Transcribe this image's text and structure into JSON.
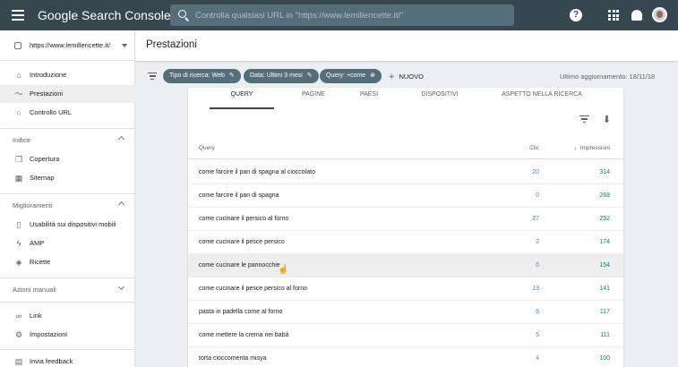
{
  "app": {
    "brand": "Google Search Console",
    "search_placeholder": "Controlla qualsiasi URL in \"https://www.lemillericette.it/\""
  },
  "colors": {
    "topbar": "#37474f",
    "chip": "#546e7a",
    "clicks": "#4285f4",
    "impressions": "#00897b"
  },
  "sidebar": {
    "property": "https://www.lemillericette.it/",
    "items_top": [
      {
        "label": "Introduzione",
        "icon": "home-icon"
      },
      {
        "label": "Prestazioni",
        "icon": "trending-icon"
      },
      {
        "label": "Controllo URL",
        "icon": "search-icon"
      }
    ],
    "index": {
      "title": "Indice",
      "items": [
        {
          "label": "Copertura",
          "icon": "copy-icon"
        },
        {
          "label": "Sitemap",
          "icon": "sitemap-icon"
        }
      ]
    },
    "enhancements": {
      "title": "Miglioramenti",
      "items": [
        {
          "label": "Usabilità sui dispositivi mobili",
          "icon": "mobile-icon"
        },
        {
          "label": "AMP",
          "icon": "amp-icon"
        },
        {
          "label": "Ricette",
          "icon": "layers-icon"
        }
      ]
    },
    "manual": {
      "title": "Azioni manuali"
    },
    "items_bottom": [
      {
        "label": "Link",
        "icon": "link-icon"
      },
      {
        "label": "Impostazioni",
        "icon": "gear-icon"
      },
      {
        "label": "Invia feedback",
        "icon": "feedback-icon"
      }
    ]
  },
  "main": {
    "title": "Prestazioni",
    "filters": [
      "Tipo di ricerca: Web",
      "Data: Ultimi 3 mesi",
      "Query: +come"
    ],
    "new_label": "NUOVO",
    "last_updated": "Ultimo aggiornamento: 18/11/18",
    "tabs": [
      "QUERY",
      "PAGINE",
      "PAESI",
      "DISPOSITIVI",
      "ASPETTO NELLA RICERCA"
    ],
    "table": {
      "headers": {
        "query": "Query",
        "clicks": "Clic",
        "impressions": "Impressioni"
      },
      "rows": [
        {
          "query": "come farcire il pan di spagna al cioccolato",
          "clicks": "20",
          "impressions": "314"
        },
        {
          "query": "come farcire il pan di spagna",
          "clicks": "0",
          "impressions": "268"
        },
        {
          "query": "come cucinare il persico al forno",
          "clicks": "27",
          "impressions": "252"
        },
        {
          "query": "come cucinare il pesce persico",
          "clicks": "2",
          "impressions": "174"
        },
        {
          "query": "come cucinare le pannocchie",
          "clicks": "0",
          "impressions": "154"
        },
        {
          "query": "come cucinare il pesce persico al forno",
          "clicks": "13",
          "impressions": "141"
        },
        {
          "query": "pasta in padella come al forno",
          "clicks": "6",
          "impressions": "117"
        },
        {
          "query": "come mettere la crema nei babà",
          "clicks": "5",
          "impressions": "111"
        },
        {
          "query": "torta cioccomenta misya",
          "clicks": "4",
          "impressions": "100"
        }
      ]
    }
  }
}
